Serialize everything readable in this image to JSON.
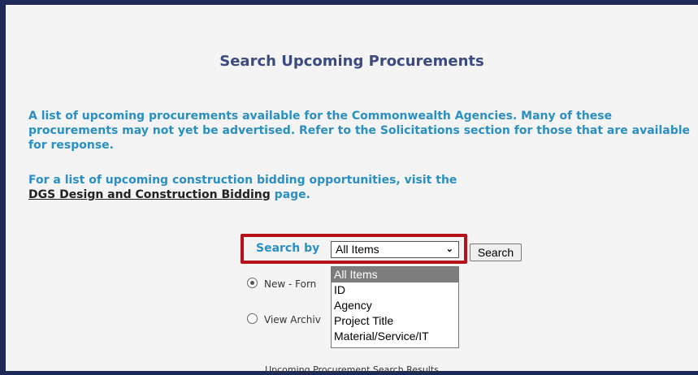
{
  "page": {
    "title": "Search Upcoming Procurements",
    "intro": "A list of upcoming procurements available for the Commonwealth Agencies. Many of these procurements may not yet be advertised. Refer to the Solicitations section for those that are available for response.",
    "construction_prefix": "For a list of upcoming construction bidding opportunities, visit the",
    "construction_link": "DGS Design and Construction Bidding",
    "construction_suffix": " page."
  },
  "search": {
    "label": "Search by",
    "selected": "All Items",
    "button_label": "Search",
    "options": [
      "All Items",
      "ID",
      "Agency",
      "Project Title",
      "Material/Service/IT"
    ]
  },
  "radios": [
    {
      "label": "New - Forn",
      "checked": true
    },
    {
      "label": "View Archiv",
      "checked": false
    }
  ],
  "results": {
    "title": "Upcoming Procurement Search Results"
  },
  "colors": {
    "title": "#3b4a80",
    "accent_text": "#2a8fc4",
    "highlight_border": "#b5121b",
    "selected_option_bg": "#7d7d7d",
    "frame_border": "#1d2a57"
  }
}
